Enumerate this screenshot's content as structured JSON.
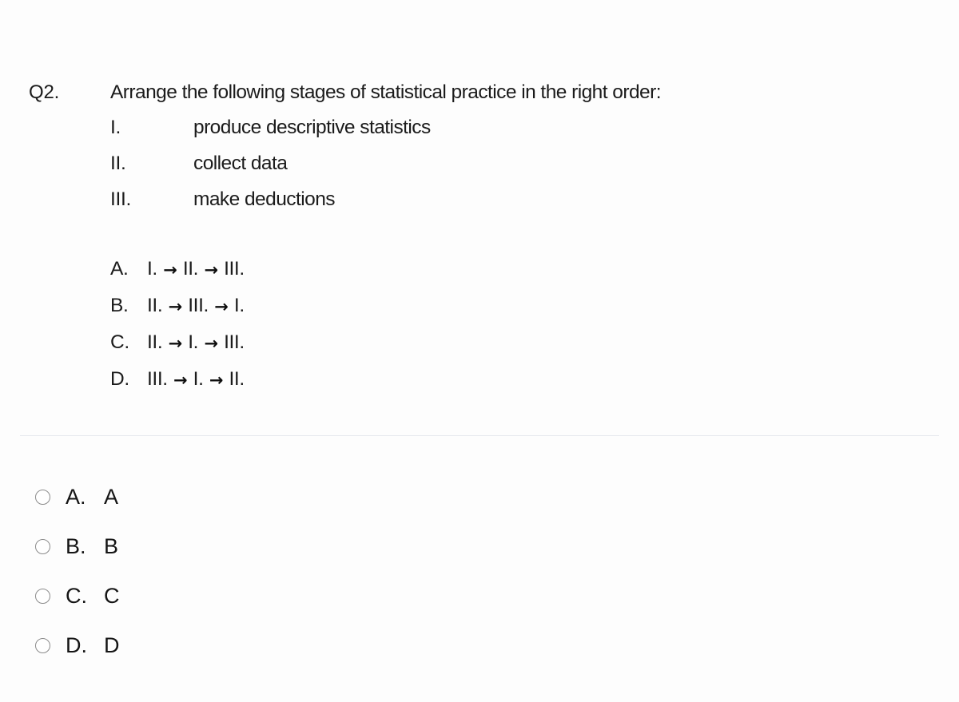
{
  "question": {
    "number": "Q2.",
    "prompt": "Arrange the following stages of statistical practice in the right order:",
    "stages": [
      {
        "numeral": "I.",
        "text": "produce descriptive statistics"
      },
      {
        "numeral": "II.",
        "text": "collect data"
      },
      {
        "numeral": "III.",
        "text": "make deductions"
      }
    ],
    "choices": [
      {
        "letter": "A.",
        "sequence": "I. → II. → III."
      },
      {
        "letter": "B.",
        "sequence": "II. → III. → I."
      },
      {
        "letter": "C.",
        "sequence": "II. → I. → III."
      },
      {
        "letter": "D.",
        "sequence": "III. → I. → II."
      }
    ]
  },
  "answer_options": [
    {
      "letter": "A.",
      "value": "A",
      "selected": false,
      "icon": "radio-unselected-icon"
    },
    {
      "letter": "B.",
      "value": "B",
      "selected": false,
      "icon": "radio-unselected-icon"
    },
    {
      "letter": "C.",
      "value": "C",
      "selected": false,
      "icon": "radio-unselected-icon"
    },
    {
      "letter": "D.",
      "value": "D",
      "selected": false,
      "icon": "radio-unselected-icon"
    }
  ],
  "colors": {
    "background": "#fdfdfd",
    "text": "#1b1b1b",
    "radio_text": "#151515",
    "divider": "#e7e9ee",
    "radio_border": "#8b8b8b"
  }
}
